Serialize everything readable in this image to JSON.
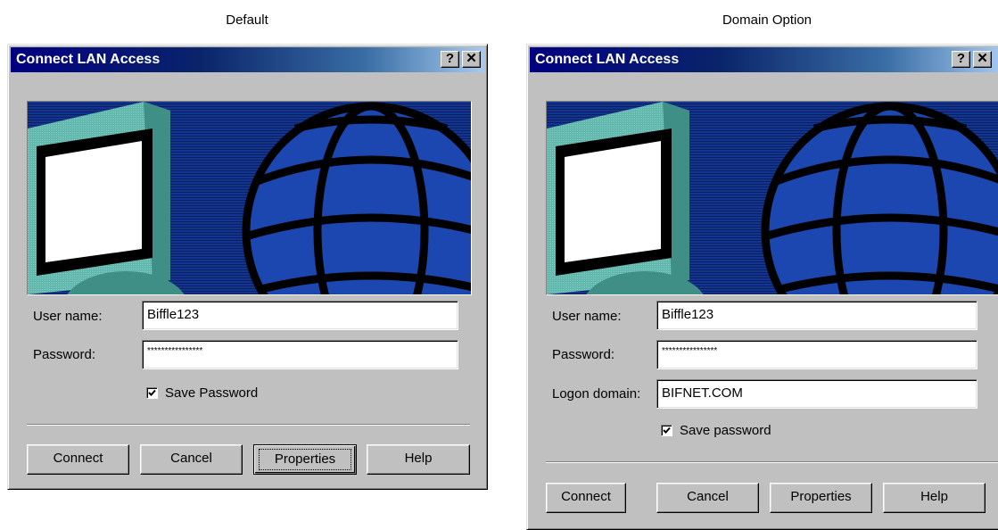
{
  "captions": {
    "left": "Default",
    "right": "Domain Option"
  },
  "left_dialog": {
    "title": "Connect LAN Access",
    "help_glyph": "?",
    "close_glyph": "✕",
    "username_label": "User name:",
    "username_value": "Biffle123",
    "password_label": "Password:",
    "password_value": "****************",
    "save_password_label": "Save Password",
    "save_password_checked": true,
    "buttons": {
      "connect": "Connect",
      "cancel": "Cancel",
      "properties": "Properties",
      "help": "Help"
    }
  },
  "right_dialog": {
    "title": "Connect LAN Access",
    "help_glyph": "?",
    "close_glyph": "✕",
    "username_label": "User name:",
    "username_value": "Biffle123",
    "password_label": "Password:",
    "password_value": "****************",
    "domain_label": "Logon domain:",
    "domain_value": "BIFNET.COM",
    "save_password_label": "Save password",
    "save_password_checked": true,
    "buttons": {
      "connect": "Connect",
      "cancel": "Cancel",
      "properties": "Properties",
      "help": "Help"
    }
  },
  "colors": {
    "titlebar": "#000080",
    "dialog_face": "#c0c0c0",
    "banner_blue": "#0f2f86",
    "monitor_teal": "#5fb3a9"
  }
}
